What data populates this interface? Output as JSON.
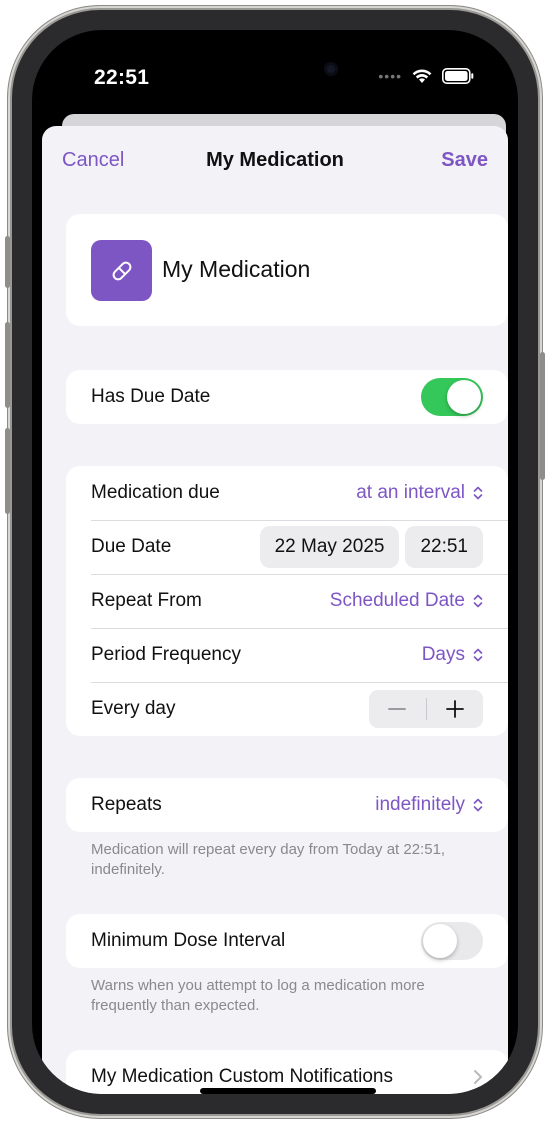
{
  "status_bar": {
    "time": "22:51"
  },
  "nav": {
    "cancel_label": "Cancel",
    "title": "My Medication",
    "save_label": "Save"
  },
  "medication": {
    "name": "My Medication",
    "icon": "pill-icon",
    "icon_color": "#7d56c4"
  },
  "has_due_date": {
    "label": "Has Due Date",
    "enabled": true
  },
  "schedule": {
    "medication_due_label": "Medication due",
    "medication_due_value": "at an interval",
    "due_date_label": "Due Date",
    "due_date_value": "22 May 2025",
    "due_time_value": "22:51",
    "repeat_from_label": "Repeat From",
    "repeat_from_value": "Scheduled Date",
    "period_frequency_label": "Period Frequency",
    "period_frequency_value": "Days",
    "every_label": "Every day"
  },
  "repeats": {
    "label": "Repeats",
    "value": "indefinitely",
    "footnote": "Medication will repeat every day from Today at 22:51, indefinitely."
  },
  "minimum_dose": {
    "label": "Minimum Dose Interval",
    "enabled": false,
    "footnote": "Warns when you attempt to log a medication more frequently than expected."
  },
  "custom_notifications": {
    "label": "My Medication Custom Notifications"
  },
  "colors": {
    "accent": "#7d56c4",
    "toggle_on": "#34c759",
    "toggle_off": "#e9e9eb",
    "background": "#f2f2f7"
  }
}
